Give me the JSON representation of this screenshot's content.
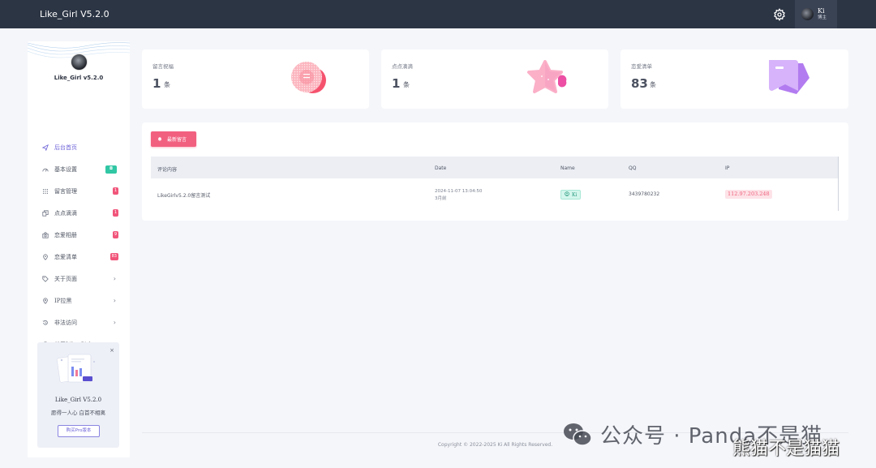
{
  "topbar": {
    "title": "Like_Girl V5.2.0",
    "user_name": "Ki",
    "user_role": "博主"
  },
  "sidebar": {
    "title": "Like_Girl v5.2.0",
    "items": [
      {
        "label": "后台首页",
        "icon": "send-icon",
        "badge": "",
        "chevron": false,
        "active": true
      },
      {
        "label": "基本设置",
        "icon": "gauge-icon",
        "badge": "◘",
        "badge_color": "#31c6a4",
        "chevron": false
      },
      {
        "label": "留言管理",
        "icon": "grid-icon",
        "badge": "1",
        "badge_color": "#f1557a",
        "chevron": false
      },
      {
        "label": "点点滴滴",
        "icon": "copy-icon",
        "badge": "1",
        "badge_color": "#f1557a",
        "chevron": false
      },
      {
        "label": "恋爱相册",
        "icon": "camera-icon",
        "badge": "9",
        "badge_color": "#f1557a",
        "chevron": false
      },
      {
        "label": "恋爱清单",
        "icon": "location-icon",
        "badge": "83",
        "badge_color": "#f1557a",
        "chevron": false
      },
      {
        "label": "关于页面",
        "icon": "tag-icon",
        "badge": "",
        "chevron": true
      },
      {
        "label": "IP拉黑",
        "icon": "pin-icon",
        "badge": "",
        "chevron": true
      },
      {
        "label": "非法访问",
        "icon": "history-icon",
        "badge": "",
        "chevron": true
      },
      {
        "label": "关于Like Girl",
        "icon": "info-icon",
        "badge": "",
        "chevron": true
      }
    ],
    "chevron_glyph": "›",
    "promo": {
      "close": "×",
      "title": "Like_Girl V5.2.0",
      "subtitle": "愿得一人心 白首不相离",
      "button": "购买Pro版本"
    }
  },
  "stats": [
    {
      "label": "留言祝福",
      "value": "1",
      "unit": "条"
    },
    {
      "label": "点点滴滴",
      "value": "1",
      "unit": "条"
    },
    {
      "label": "恋爱清单",
      "value": "83",
      "unit": "条"
    }
  ],
  "panel": {
    "refresh_label": "最新留言",
    "columns": [
      "评论内容",
      "Date",
      "Name",
      "QQ",
      "IP"
    ],
    "rows": [
      {
        "content": "LikeGirlv5.2.0留言测试",
        "date": "2024-11-07 13:04:50",
        "relative": "3月前",
        "name": "Ki",
        "qq": "3439780232",
        "ip": "112.97.203.248"
      }
    ]
  },
  "footer": {
    "copyright": "Copyright © 2022-2025 Ki All Rights Reserved."
  },
  "watermark": {
    "text1": "公众号 · Panda不是猫",
    "text2": "熊猫不是猫猫"
  }
}
